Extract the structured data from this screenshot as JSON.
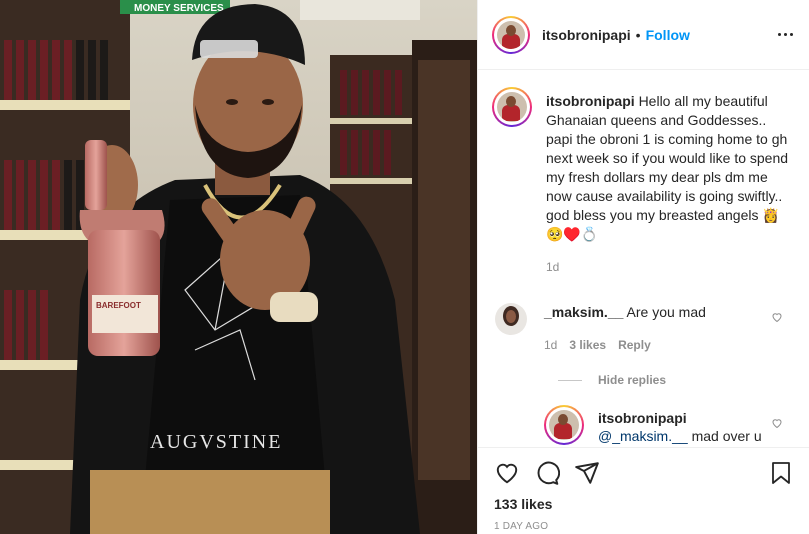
{
  "post": {
    "username": "itsobronipapi",
    "follow_label": "Follow",
    "separator": "•"
  },
  "caption": {
    "username": "itsobronipapi",
    "text": "Hello all my beautiful Ghanaian queens and Goddesses.. papi the obroni 1 is coming home to gh next week so if you would like to spend my fresh dollars my dear pls dm me now cause availability is going swiftly.. god bless you my breasted angels 👸🥺♥️💍",
    "time": "1d"
  },
  "comment": {
    "username": "_maksim.__",
    "text": "Are you mad",
    "time": "1d",
    "likes": "3 likes",
    "reply_label": "Reply",
    "hide_replies_label": "Hide replies"
  },
  "reply": {
    "username": "itsobronipapi",
    "mention": "@_maksim.__",
    "text": "mad over u girl"
  },
  "footer": {
    "likes": "133 likes",
    "date": "1 DAY AGO"
  },
  "photo": {
    "sign_text": "MONEY SERVICES",
    "shirt_text": "AUGVSTINE",
    "bottle_label": "BAREFOOT"
  },
  "colors": {
    "link_blue": "#0095f6",
    "meta_gray": "#8e8e8e",
    "text": "#262626"
  },
  "icons": [
    "more-icon",
    "heart-icon",
    "comment-icon",
    "share-icon",
    "bookmark-icon",
    "small-heart-icon"
  ]
}
